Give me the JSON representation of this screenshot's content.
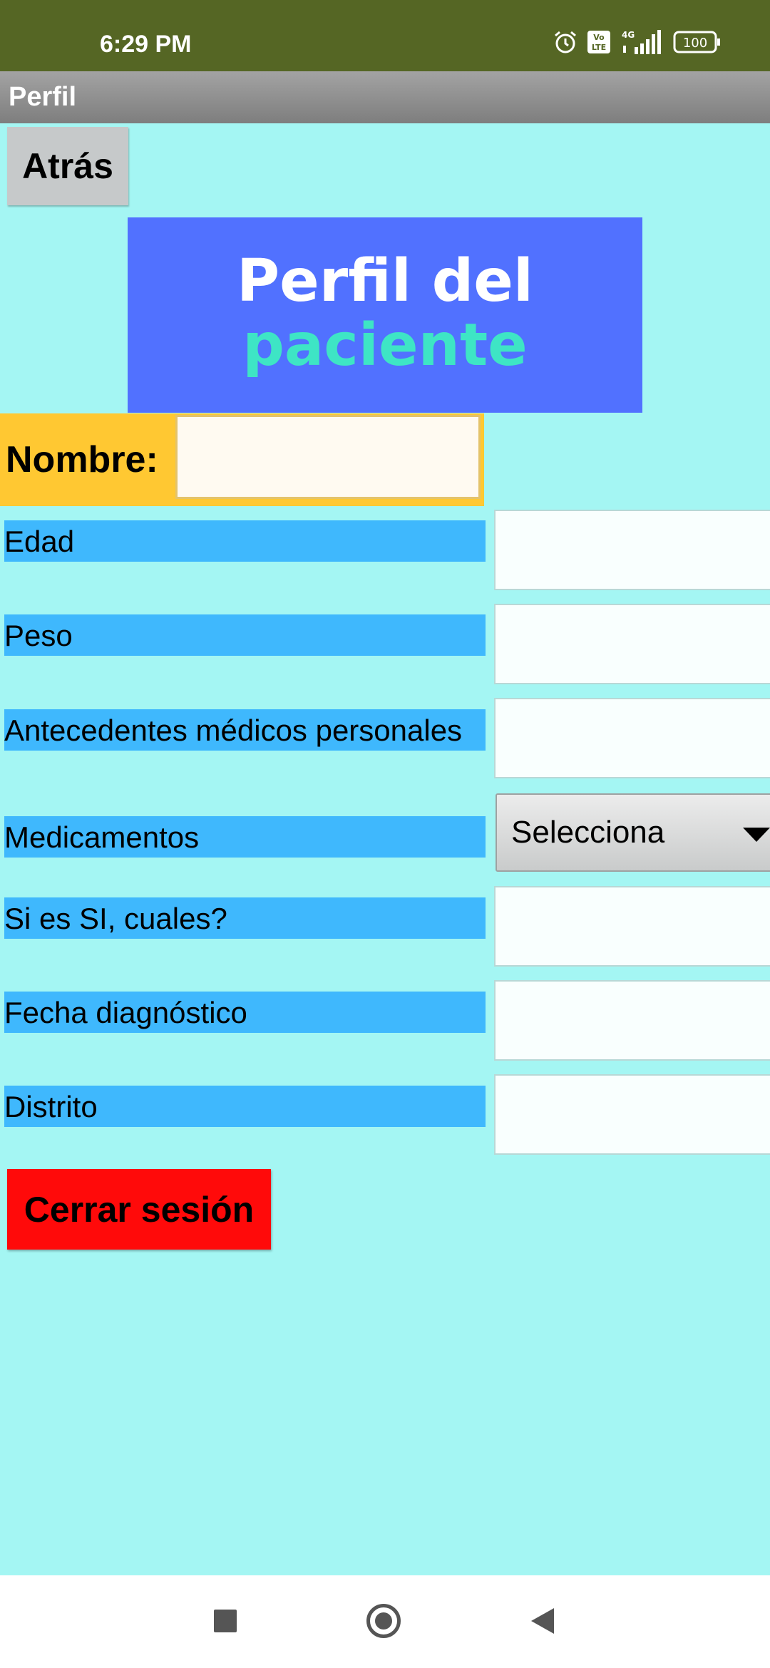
{
  "status_bar": {
    "time": "6:29 PM",
    "battery": "100",
    "network": "4G",
    "volte": "Vo LTE"
  },
  "app_bar": {
    "title": "Perfil"
  },
  "back_button": {
    "label": "Atrás"
  },
  "header": {
    "line1": "Perfil del",
    "line2": "paciente"
  },
  "name_field": {
    "label": "Nombre:",
    "value": ""
  },
  "fields": [
    {
      "label": "Edad",
      "value": ""
    },
    {
      "label": "Peso",
      "value": ""
    },
    {
      "label": "Antecedentes médicos personales",
      "value": ""
    },
    {
      "label": "Medicamentos",
      "selected": "Selecciona"
    },
    {
      "label": "Si es SI, cuales?",
      "value": ""
    },
    {
      "label": "Fecha diagnóstico",
      "value": ""
    },
    {
      "label": "Distrito",
      "value": ""
    }
  ],
  "logout_button": {
    "label": "Cerrar sesión"
  },
  "colors": {
    "status_bar": "#556624",
    "background": "#A4F6F3",
    "header_box": "#5171FF",
    "header_accent": "#3EE5C5",
    "name_row": "#FFC832",
    "field_label": "#3FB8FD",
    "logout": "#FF0A0A"
  }
}
